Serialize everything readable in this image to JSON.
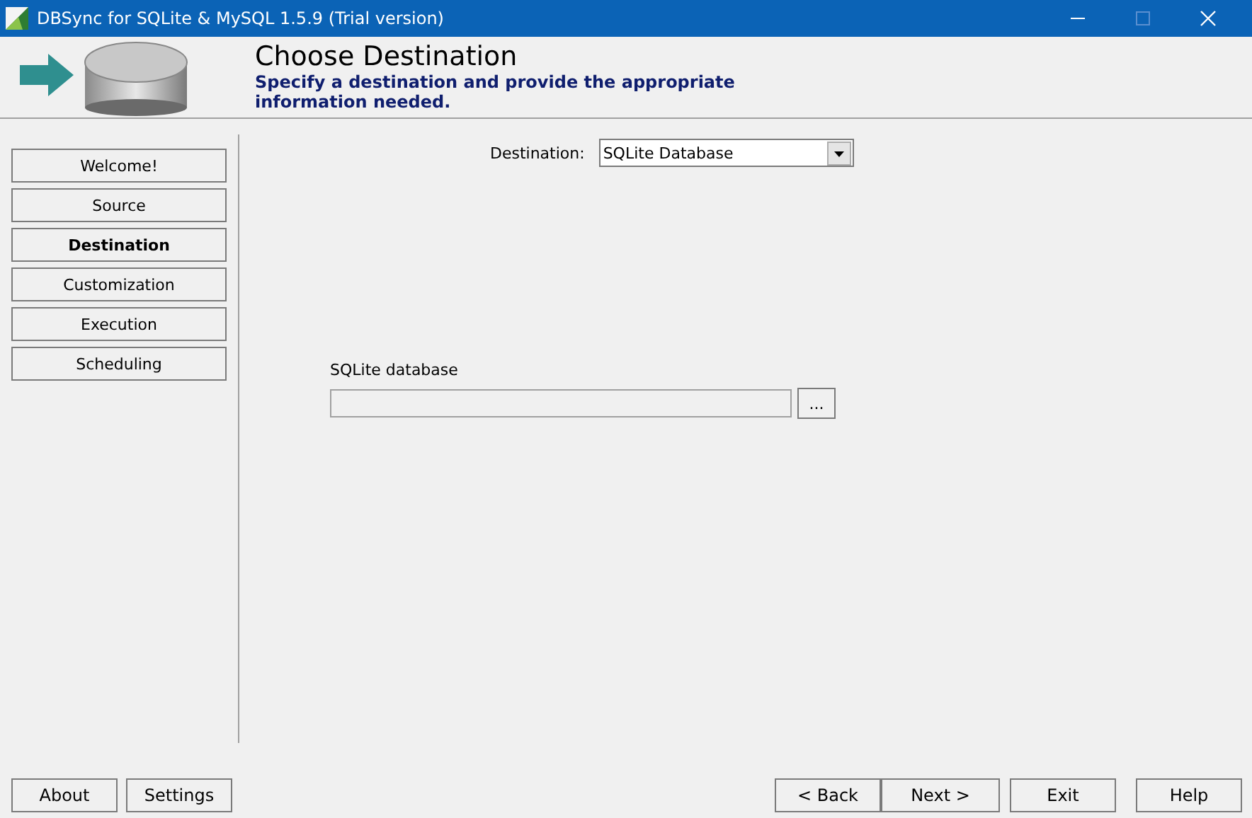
{
  "window": {
    "title": "DBSync for SQLite & MySQL 1.5.9 (Trial version)"
  },
  "header": {
    "title": "Choose Destination",
    "subtitle": "Specify a destination and provide the appropriate information needed."
  },
  "sidebar": {
    "items": [
      {
        "label": "Welcome!",
        "selected": false
      },
      {
        "label": "Source",
        "selected": false
      },
      {
        "label": "Destination",
        "selected": true
      },
      {
        "label": "Customization",
        "selected": false
      },
      {
        "label": "Execution",
        "selected": false
      },
      {
        "label": "Scheduling",
        "selected": false
      }
    ]
  },
  "destination": {
    "label": "Destination:",
    "value": "SQLite Database"
  },
  "database": {
    "label": "SQLite database",
    "browse": "..."
  },
  "footer": {
    "left": [
      "About",
      "Settings"
    ],
    "nav": [
      "< Back",
      "Next >"
    ],
    "right": [
      "Exit",
      "Help"
    ]
  }
}
